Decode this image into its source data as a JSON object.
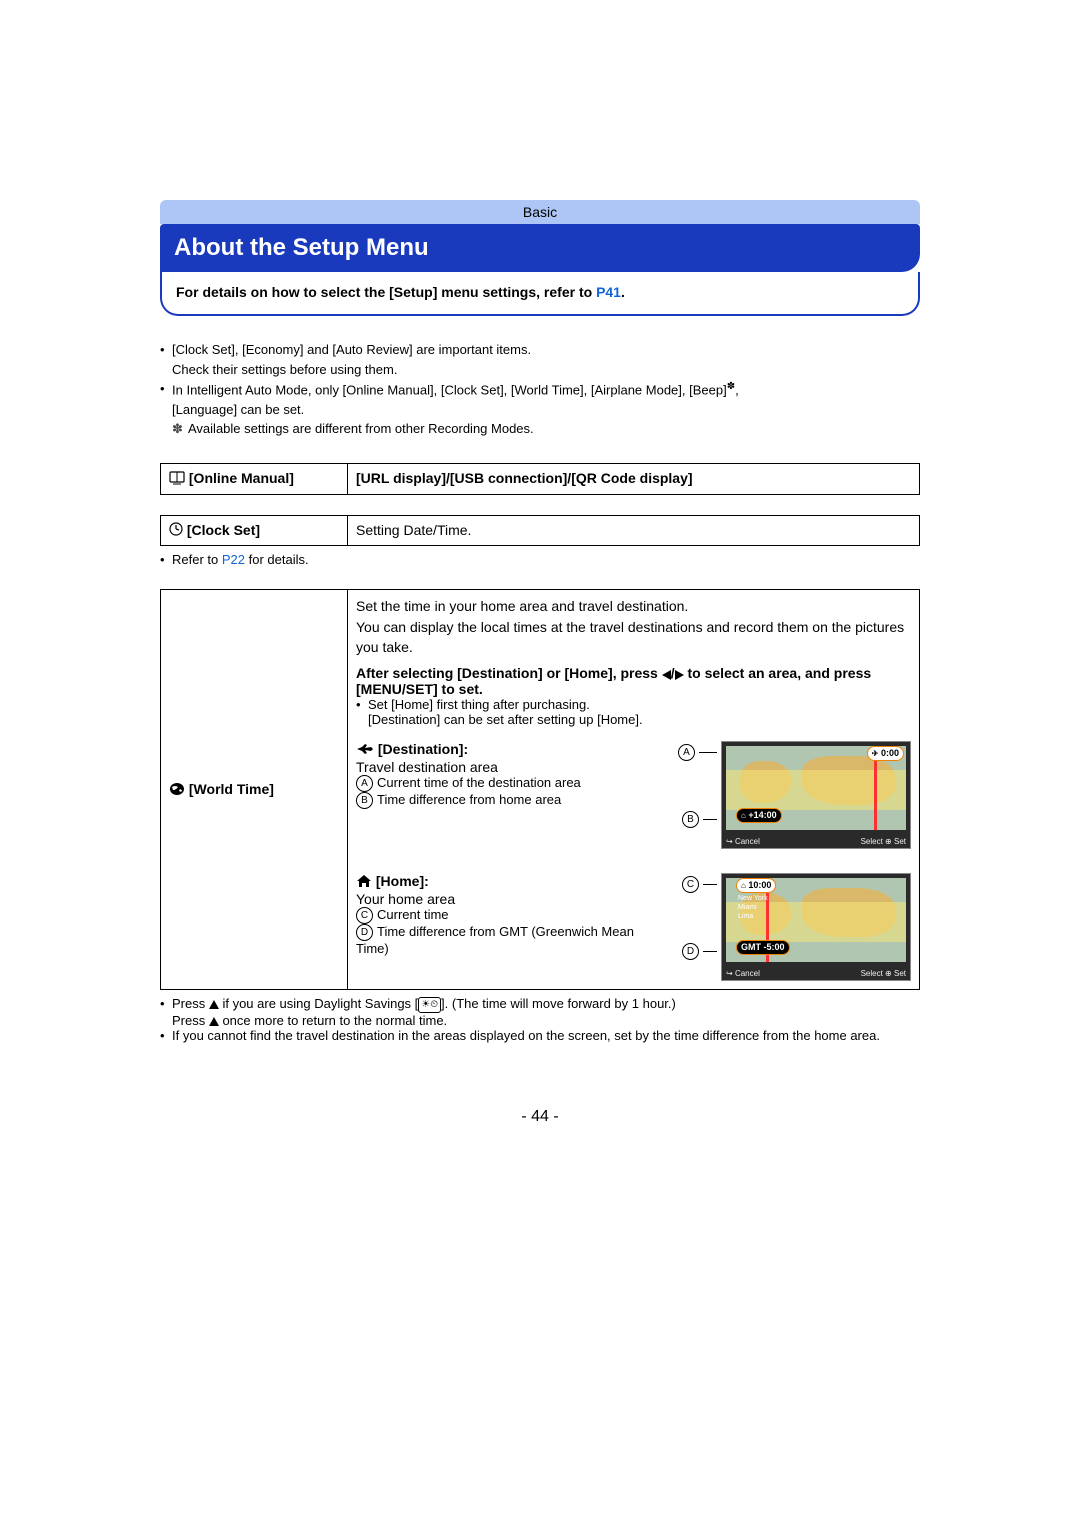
{
  "header": {
    "section": "Basic"
  },
  "title": "About the Setup Menu",
  "subtitle": {
    "prefix": "For details on how to select the [Setup] menu settings, refer to ",
    "link": "P41",
    "suffix": "."
  },
  "intro": {
    "line1": "[Clock Set], [Economy] and [Auto Review] are important items.",
    "line1b": "Check their settings before using them.",
    "line2a": "In Intelligent Auto Mode, only [Online Manual], [Clock Set], [World Time], [Airplane Mode], [Beep]",
    "line2a_suffix": ",",
    "line2b": "[Language] can be set.",
    "asterisk_note": "Available settings are different from other Recording Modes."
  },
  "tables": {
    "online_manual": {
      "label": "[Online Manual]",
      "value": "[URL display]/[USB connection]/[QR Code display]"
    },
    "clock_set": {
      "label": "[Clock Set]",
      "value": "Setting Date/Time."
    }
  },
  "clock_note": {
    "prefix": "Refer to ",
    "link": "P22",
    "suffix": " for details."
  },
  "world_time": {
    "label": "[World Time]",
    "desc1": "Set the time in your home area and travel destination.",
    "desc2": "You can display the local times at the travel destinations and record them on the pictures you take.",
    "instr_a": "After selecting [Destination] or [Home], press ",
    "instr_b": " to select an area, and press [MENU/SET] to set.",
    "sub1": "Set [Home] first thing after purchasing.",
    "sub2": "[Destination] can be set after setting up [Home].",
    "dest": {
      "title": "[Destination]:",
      "desc": "Travel destination area",
      "a": "Current time of the destination area",
      "b": "Time difference from home area"
    },
    "home": {
      "title": "[Home]:",
      "desc": "Your home area",
      "c": "Current time",
      "d": "Time difference from GMT (Greenwich Mean Time)"
    }
  },
  "footnotes": {
    "f1a": "Press ",
    "f1b": " if you are using Daylight Savings [",
    "f1c": "]. (The time will move forward by 1 hour.)",
    "f1d": "Press ",
    "f1e": " once more to return to the normal time.",
    "f2": "If you cannot find the travel destination in the areas displayed on the screen, set by the time difference from the home area."
  },
  "illustrations": {
    "dest": {
      "time": "0:00",
      "diff": "+14:00",
      "cancel": "Cancel",
      "select": "Select",
      "set": "Set"
    },
    "home": {
      "time": "10:00",
      "diff": "GMT -5:00",
      "city1": "New York",
      "city2": "Miami",
      "city3": "Lima",
      "cancel": "Cancel",
      "select": "Select",
      "set": "Set"
    }
  },
  "callouts": {
    "A": "A",
    "B": "B",
    "C": "C",
    "D": "D"
  },
  "page_number": "- 44 -"
}
